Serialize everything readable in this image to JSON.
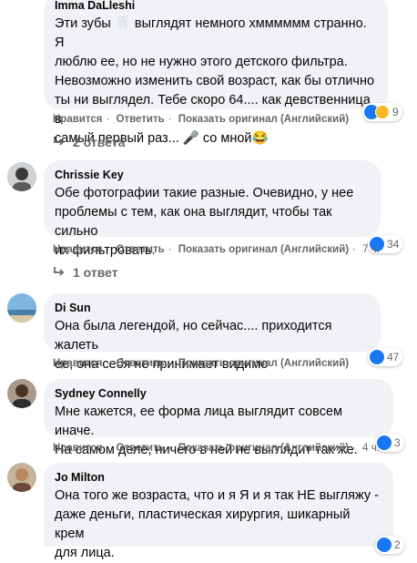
{
  "comments": [
    {
      "author": "Imma DaLleshi",
      "lines": [
        "Эти зубы 🦷 выглядят немного хмммммм странно. Я",
        "люблю ее, но не нужно этого детского фильтра.",
        "Невозможно изменить свой возраст, как бы отлично",
        "ты ни выглядел. Тебе скоро 64.... как девственница в",
        "самый первый раз... 🎤 со мной😂"
      ],
      "like": "Нравится",
      "reply": "Ответить",
      "translate": "Показать оригинал (Английский)",
      "reactions": "9",
      "replies": "2 ответа"
    },
    {
      "author": "Chrissie Key",
      "lines": [
        "Обе фотографии такие разные. Очевидно, у нее",
        "проблемы с тем, как она выглядит, чтобы так сильно",
        "их фильтровать."
      ],
      "like": "Нравится",
      "reply": "Ответить",
      "translate": "Показать оригинал (Английский)",
      "time": "7 ч.",
      "reactions": "34",
      "replies": "1 ответ"
    },
    {
      "author": "Di Sun",
      "lines": [
        "Она была легендой, но сейчас.... приходится жалеть",
        "ее, она себя не принимает видимо"
      ],
      "like": "Нравится",
      "reply": "Ответить",
      "translate": "Показать оригинал (Английский)",
      "reactions": "47"
    },
    {
      "author": "Sydney Connelly",
      "lines": [
        "Мне кажется, ее форма лица выглядит совсем иначе.",
        "На самом деле, ничего в ней не выглядит так же."
      ],
      "like": "Нравится",
      "reply": "Ответить",
      "translate": "Показать оригинал (Английский)",
      "time": "4 ч.",
      "reactions": "3"
    },
    {
      "author": "Jo Milton",
      "lines": [
        "Она того же возраста, что и я Я и я так НЕ выгляжу -",
        "даже деньги, пластическая хирургия, шикарный крем",
        "для лица."
      ],
      "reactions": "2"
    }
  ],
  "colors": {
    "bubble": "#f0f2f5",
    "meta": "#65676b",
    "like": "#1877f2",
    "haha": "#f7b928"
  },
  "icons": [
    "like-icon",
    "haha-icon",
    "reply-arrow-icon"
  ]
}
